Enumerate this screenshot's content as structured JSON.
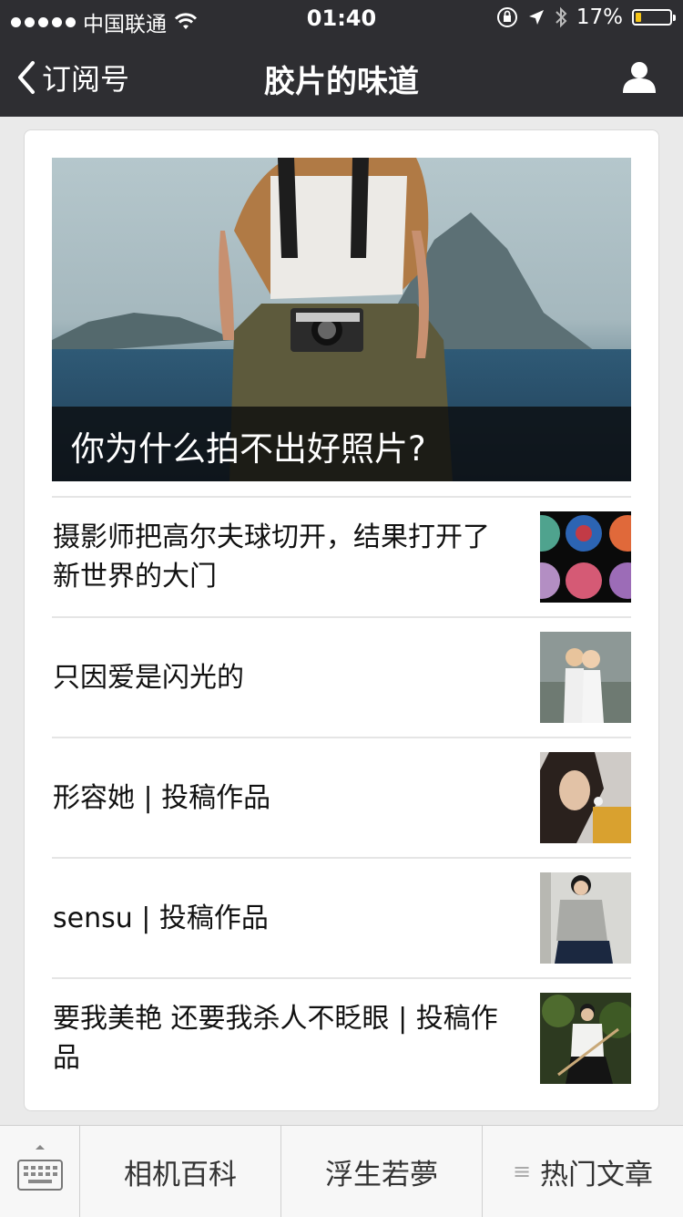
{
  "status_bar": {
    "carrier": "中国联通",
    "time": "01:40",
    "battery": "17%",
    "battery_level": 0.17
  },
  "nav": {
    "back_label": "订阅号",
    "title": "胶片的味道"
  },
  "feature": {
    "title": "你为什么拍不出好照片?"
  },
  "articles": [
    {
      "title": "摄影师把高尔夫球切开，结果打开了新世界的大门"
    },
    {
      "title": "只因爱是闪光的"
    },
    {
      "title": "形容她 | 投稿作品"
    },
    {
      "title": "sensu | 投稿作品"
    },
    {
      "title": "要我美艳 还要我杀人不眨眼 | 投稿作品"
    }
  ],
  "menu": {
    "items": [
      "相机百科",
      "浮生若夢",
      "热门文章"
    ]
  },
  "colors": {
    "nav_bg": "#2e2e32",
    "page_bg": "#eaeaea",
    "battery_fill": "#f5c518"
  },
  "icons": [
    "signal-dots-icon",
    "wifi-icon",
    "orientation-lock-icon",
    "location-icon",
    "bluetooth-icon",
    "battery-icon",
    "back-chevron-icon",
    "profile-icon",
    "keyboard-icon",
    "menu-icon"
  ]
}
